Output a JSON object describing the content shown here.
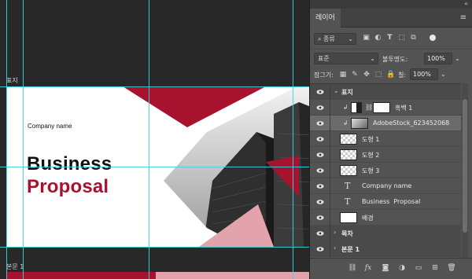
{
  "canvas": {
    "artboard_labels": [
      "표지",
      "본문 1"
    ],
    "artboard": {
      "company_name": "Company name",
      "title_line1": "Business",
      "title_line2": "Proposal"
    },
    "colors": {
      "accent_red": "#a7132e",
      "light_red": "#e2a3ad",
      "guide": "#34d8e0"
    }
  },
  "panel": {
    "tab": "레이어",
    "filter": {
      "kind_label": "종류",
      "icons": [
        "image-filter-icon",
        "adjustment-filter-icon",
        "type-filter-icon",
        "shape-filter-icon",
        "smart-object-filter-icon"
      ]
    },
    "blend_mode": "표준",
    "opacity_label": "불투명도:",
    "opacity_value": "100%",
    "lock_label": "잠그기:",
    "fill_label": "칠:",
    "fill_value": "100%",
    "layers": [
      {
        "name": "표지",
        "kind": "group",
        "expanded": true
      },
      {
        "name": "흑백 1",
        "kind": "adjustment"
      },
      {
        "name": "AdobeStock_623452068",
        "kind": "smart-object",
        "selected": true
      },
      {
        "name": "도형 1",
        "kind": "shape"
      },
      {
        "name": "도형 2",
        "kind": "shape"
      },
      {
        "name": "도형 3",
        "kind": "shape"
      },
      {
        "name": "Company name",
        "kind": "text"
      },
      {
        "name": "Business  Proposal",
        "kind": "text"
      },
      {
        "name": "배경",
        "kind": "fill"
      },
      {
        "name": "목차",
        "kind": "group",
        "expanded": false
      },
      {
        "name": "본문 1",
        "kind": "group",
        "expanded": false
      }
    ],
    "footer_icons": [
      "link-icon",
      "fx-icon",
      "mask-icon",
      "adjustment-icon",
      "group-icon",
      "new-layer-icon",
      "delete-icon"
    ]
  }
}
